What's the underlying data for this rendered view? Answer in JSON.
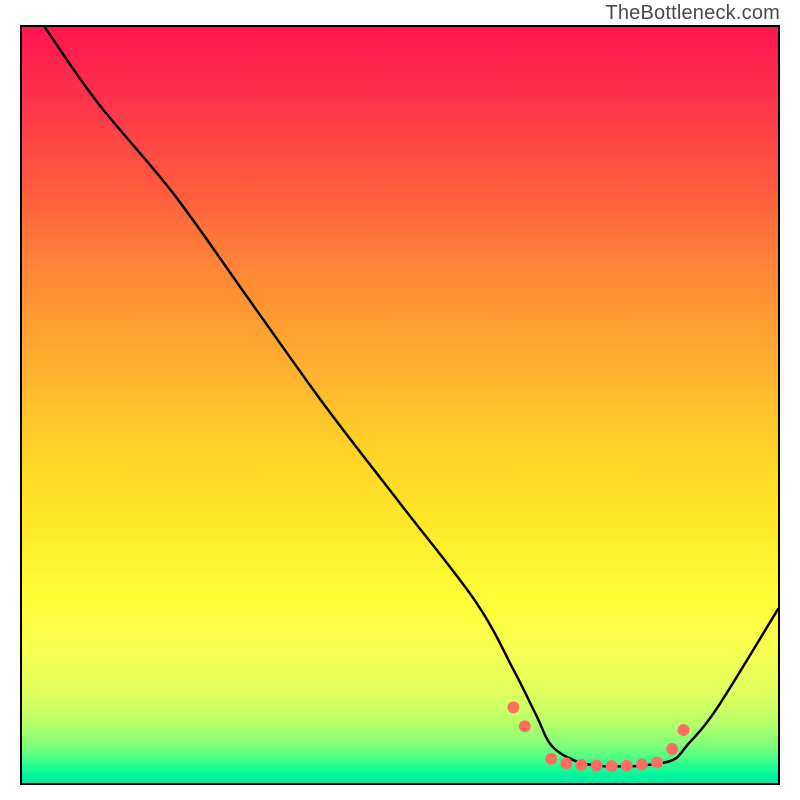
{
  "attribution": "TheBottleneck.com",
  "chart_data": {
    "type": "line",
    "title": "",
    "xlabel": "",
    "ylabel": "",
    "xlim": [
      0,
      100
    ],
    "ylim": [
      0,
      100
    ],
    "grid": false,
    "legend": false,
    "series": [
      {
        "name": "curve",
        "color": "#000000",
        "x": [
          3,
          10,
          20,
          30,
          40,
          50,
          60,
          65,
          68,
          70,
          73,
          76,
          79,
          82,
          86,
          88,
          92,
          100
        ],
        "y": [
          100,
          90,
          78,
          64,
          50,
          37,
          24,
          15,
          9,
          5,
          3,
          2.3,
          2.2,
          2.3,
          3,
          5,
          10,
          23
        ]
      }
    ],
    "markers": {
      "name": "highlight-dots",
      "color": "#ff6f61",
      "radius": 6,
      "x": [
        65,
        66.5,
        70,
        72,
        74,
        76,
        78,
        80,
        82,
        84,
        86,
        87.5
      ],
      "y": [
        10,
        7.5,
        3.2,
        2.6,
        2.4,
        2.3,
        2.25,
        2.3,
        2.45,
        2.7,
        4.5,
        7
      ]
    },
    "background_gradient": {
      "orientation": "vertical",
      "stops": [
        {
          "pos": 0.0,
          "color": "#ff1550"
        },
        {
          "pos": 0.2,
          "color": "#ff5640"
        },
        {
          "pos": 0.45,
          "color": "#ffad30"
        },
        {
          "pos": 0.7,
          "color": "#fffd36"
        },
        {
          "pos": 0.9,
          "color": "#b8ff68"
        },
        {
          "pos": 1.0,
          "color": "#00e8a5"
        }
      ]
    }
  }
}
